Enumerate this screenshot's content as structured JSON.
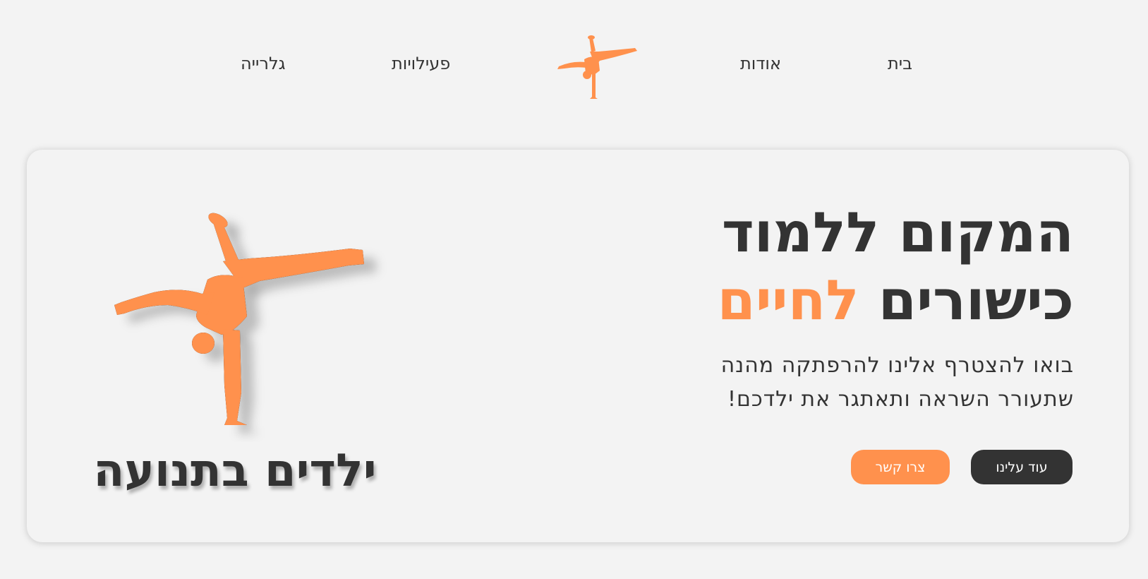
{
  "nav": {
    "items": [
      {
        "label": "בית"
      },
      {
        "label": "אודות"
      },
      {
        "label": "פעילויות"
      },
      {
        "label": "גלרייה"
      }
    ]
  },
  "hero": {
    "headline_line1": "המקום ללמוד",
    "headline_line2_word1": "כישורים",
    "headline_line2_accent": "לחיים",
    "subtitle_line1": "בואו להצטרף אלינו להרפתקה מהנה",
    "subtitle_line2": "שתעורר השראה ותאתגר את ילדכם!",
    "primary_button": "עוד עלינו",
    "secondary_button": "צרו קשר",
    "brand_name": "ילדים בתנועה",
    "logo_icon": "breakdancer-silhouette-icon"
  },
  "colors": {
    "accent": "#ff914d",
    "dark": "#333333",
    "background": "#f3f3f3"
  }
}
